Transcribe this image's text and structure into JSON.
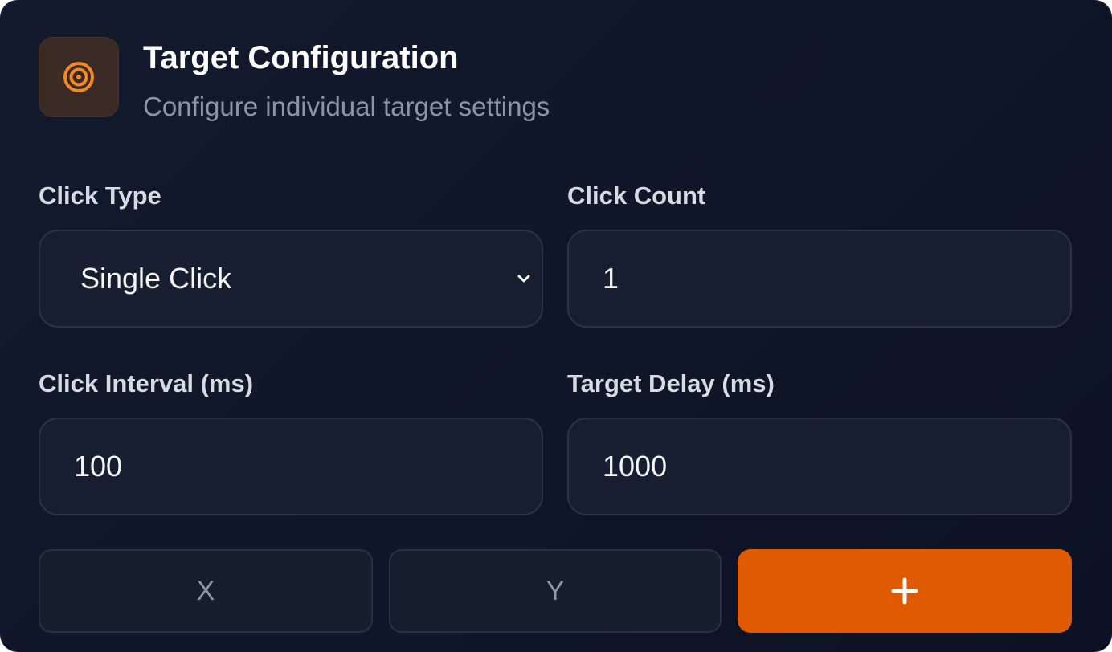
{
  "header": {
    "icon": "target-icon",
    "title": "Target Configuration",
    "subtitle": "Configure individual target settings"
  },
  "click_type": {
    "label": "Click Type",
    "selected": "Single Click",
    "icon": "chevron-down-icon"
  },
  "click_count": {
    "label": "Click Count",
    "value": "1"
  },
  "click_interval": {
    "label": "Click Interval (ms)",
    "value": "100"
  },
  "target_delay": {
    "label": "Target Delay (ms)",
    "value": "1000"
  },
  "coordinates": {
    "x_placeholder": "X",
    "y_placeholder": "Y"
  },
  "add_button": {
    "icon": "plus-icon"
  },
  "colors": {
    "background": "#0f1628",
    "accent": "#df5a00",
    "icon_orange": "#f08a24"
  }
}
